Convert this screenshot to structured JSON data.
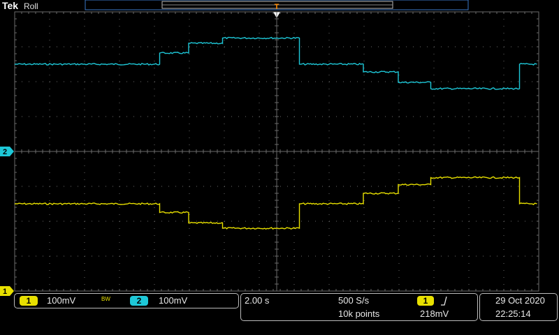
{
  "header": {
    "brand": "Tek",
    "mode": "Roll",
    "trigger_marker": "T"
  },
  "markers": {
    "ch2_ground": "2",
    "ch1_ground": "1"
  },
  "channels": [
    {
      "num": "1",
      "scale": "100mV",
      "color": "#e8e000"
    },
    {
      "num": "2",
      "scale": "100mV",
      "color": "#1ec8d8"
    }
  ],
  "bandwidth_indicator": "BW",
  "timebase": {
    "scale": "2.00 s",
    "sample_rate": "500 S/s",
    "record_length": "10k points"
  },
  "trigger": {
    "source": "1",
    "slope_icon": "rising-edge-icon",
    "level": "218mV"
  },
  "datetime": {
    "date": "29 Oct  2020",
    "time": "22:25:14"
  },
  "colors": {
    "grid": "#6a6a6a",
    "ch1": "#e8e000",
    "ch2": "#1ec8d8",
    "trigger_marker": "#ff8a00"
  },
  "chart_data": {
    "type": "line",
    "title": "",
    "xlabel": "",
    "ylabel": "",
    "x_divisions": 15,
    "y_divisions": 8,
    "units": "divisions",
    "xlim": [
      0,
      15
    ],
    "ylim": [
      -4,
      4
    ],
    "grid": true,
    "series": [
      {
        "name": "",
        "channel": "2",
        "color": "#1ec8d8",
        "x": [
          0,
          4.15,
          4.15,
          4.98,
          4.98,
          5.95,
          5.95,
          8.15,
          8.15,
          9.98,
          9.98,
          10.98,
          10.98,
          11.91,
          11.91,
          14.45,
          14.45,
          14.95
        ],
        "y": [
          2.5,
          2.5,
          2.82,
          2.82,
          3.1,
          3.1,
          3.25,
          3.25,
          2.5,
          2.5,
          2.28,
          2.28,
          1.98,
          1.98,
          1.8,
          1.8,
          2.5,
          2.5
        ]
      },
      {
        "name": "",
        "channel": "1",
        "color": "#e8e000",
        "x": [
          0,
          4.15,
          4.15,
          4.98,
          4.98,
          5.95,
          5.95,
          8.15,
          8.15,
          9.98,
          9.98,
          10.98,
          10.98,
          11.91,
          11.91,
          14.45,
          14.45,
          14.95
        ],
        "y": [
          -1.5,
          -1.5,
          -1.75,
          -1.75,
          -2.05,
          -2.05,
          -2.2,
          -2.2,
          -1.5,
          -1.5,
          -1.2,
          -1.2,
          -0.95,
          -0.95,
          -0.75,
          -0.75,
          -1.5,
          -1.5
        ]
      }
    ]
  }
}
